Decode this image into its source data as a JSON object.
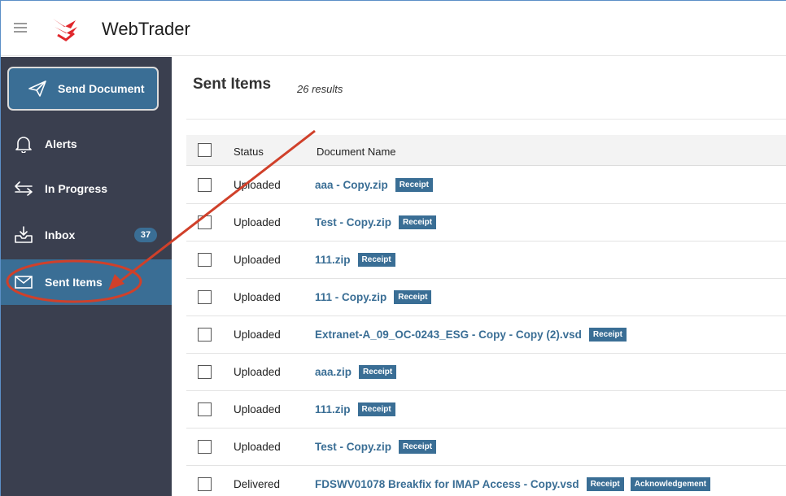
{
  "app": {
    "title": "WebTrader",
    "accent_color": "#3a6e95",
    "sidebar_color": "#3a3f4f",
    "logo_color": "#e0262b"
  },
  "sidebar": {
    "send_button": {
      "label": "Send Document",
      "icon": "paper-plane-icon"
    },
    "items": [
      {
        "label": "Alerts",
        "icon": "bell-icon"
      },
      {
        "label": "In Progress",
        "icon": "arrows-exchange-icon"
      },
      {
        "label": "Inbox",
        "icon": "inbox-tray-icon",
        "badge": "37"
      },
      {
        "label": "Sent Items",
        "icon": "envelope-icon",
        "active": true
      }
    ]
  },
  "main": {
    "title": "Sent Items",
    "results": "26 results",
    "columns": [
      "Status",
      "Document Name"
    ],
    "rows": [
      {
        "status": "Uploaded",
        "name": "aaa - Copy.zip",
        "tags": [
          "Receipt"
        ]
      },
      {
        "status": "Uploaded",
        "name": "Test - Copy.zip",
        "tags": [
          "Receipt"
        ]
      },
      {
        "status": "Uploaded",
        "name": "111.zip",
        "tags": [
          "Receipt"
        ]
      },
      {
        "status": "Uploaded",
        "name": "111 - Copy.zip",
        "tags": [
          "Receipt"
        ]
      },
      {
        "status": "Uploaded",
        "name": "Extranet-A_09_OC-0243_ESG - Copy - Copy (2).vsd",
        "tags": [
          "Receipt"
        ]
      },
      {
        "status": "Uploaded",
        "name": "aaa.zip",
        "tags": [
          "Receipt"
        ]
      },
      {
        "status": "Uploaded",
        "name": "111.zip",
        "tags": [
          "Receipt"
        ]
      },
      {
        "status": "Uploaded",
        "name": "Test - Copy.zip",
        "tags": [
          "Receipt"
        ]
      },
      {
        "status": "Delivered",
        "name": "FDSWV01078 Breakfix for IMAP Access - Copy.vsd",
        "tags": [
          "Receipt",
          "Acknowledgement"
        ]
      }
    ]
  },
  "annotation": {
    "color": "#d0402a"
  }
}
